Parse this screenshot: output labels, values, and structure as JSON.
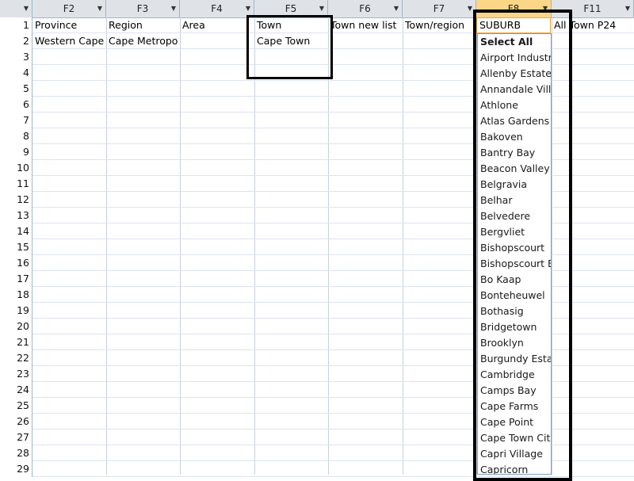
{
  "columns": [
    {
      "label": "F2"
    },
    {
      "label": "F3"
    },
    {
      "label": "F4"
    },
    {
      "label": "F5"
    },
    {
      "label": "F6"
    },
    {
      "label": "F7"
    },
    {
      "label": "F8"
    },
    {
      "label": "F11"
    }
  ],
  "row_numbers": [
    "1",
    "2",
    "3",
    "4",
    "5",
    "6",
    "7",
    "8",
    "9",
    "10",
    "11",
    "12",
    "13",
    "14",
    "15",
    "16",
    "17",
    "18",
    "19",
    "20",
    "21",
    "22",
    "23",
    "24",
    "25",
    "26",
    "27",
    "28",
    "29"
  ],
  "row1": [
    "Province",
    "Region",
    "Area",
    "Town",
    "Town new list",
    "Town/region",
    "SUBURB",
    "All Town P24"
  ],
  "row2": [
    "Western Cape",
    "Cape Metropo",
    "",
    "Cape Town",
    "",
    "",
    "",
    ""
  ],
  "filter_value": "SUBURB",
  "dropdown_items": [
    "Select All",
    "Airport Industr",
    "Allenby Estate",
    "Annandale Vill",
    "Athlone",
    "Atlas Gardens",
    "Bakoven",
    "Bantry Bay",
    "Beacon Valley",
    "Belgravia",
    "Belhar",
    "Belvedere",
    "Bergvliet",
    "Bishopscourt",
    "Bishopscourt E",
    "Bo Kaap",
    "Bonteheuwel",
    "Bothasig",
    "Bridgetown",
    "Brooklyn",
    "Burgundy Estat",
    "Cambridge",
    "Camps Bay",
    "Cape Farms",
    "Cape Point",
    "Cape Town Cit",
    "Capri Village",
    "Capricorn"
  ]
}
